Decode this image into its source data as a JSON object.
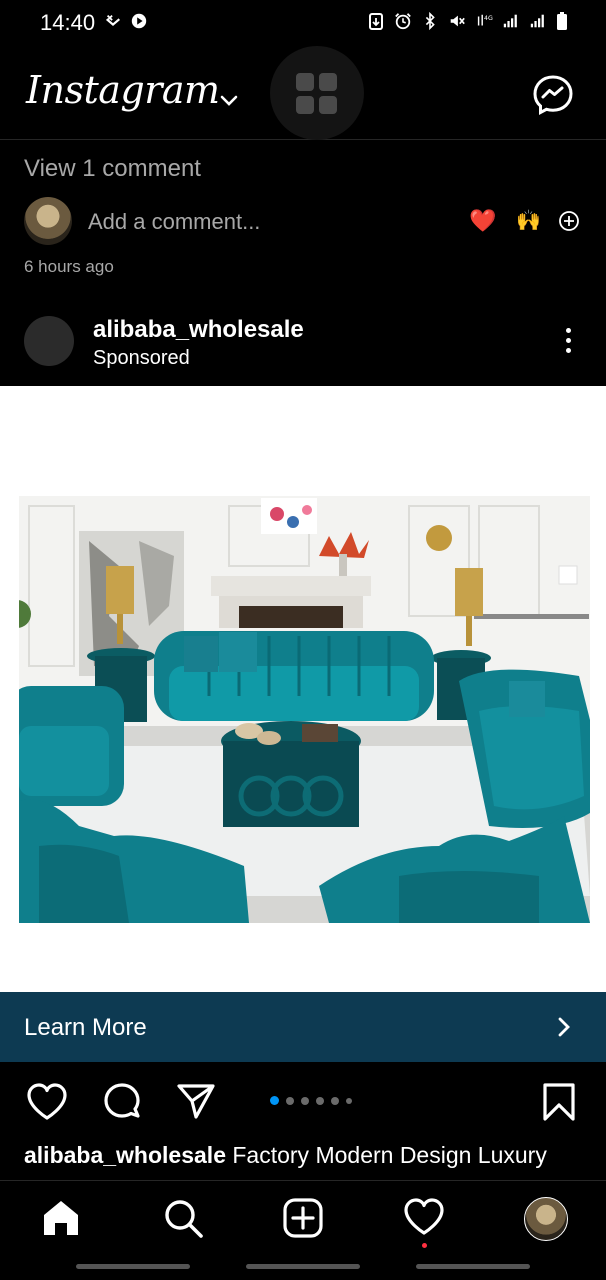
{
  "status_bar": {
    "time": "14:40",
    "left_icons": [
      "missed-call-icon",
      "youtube-icon"
    ],
    "right_icons": [
      "battery-saver-icon",
      "alarm-icon",
      "bluetooth-icon",
      "mute-icon",
      "signal-icon",
      "signal-icon",
      "signal-icon",
      "battery-icon"
    ]
  },
  "app_bar": {
    "logo_text": "Instagram",
    "icons": [
      "chevron-down-icon",
      "grid-icon",
      "messenger-icon"
    ]
  },
  "previous_post": {
    "view_comments": "View 1 comment",
    "add_comment_placeholder": "Add a comment...",
    "quick_reactions": [
      "❤️",
      "🙌"
    ],
    "time_ago": "6 hours ago"
  },
  "sponsored_post": {
    "username": "alibaba_wholesale",
    "label": "Sponsored",
    "cta_label": "Learn More",
    "carousel": {
      "count": 6,
      "active_index": 0
    },
    "caption_user": "alibaba_wholesale",
    "caption_text": "Factory Modern Design Luxury"
  },
  "colors": {
    "background": "#000000",
    "cta_background": "#0d3a52",
    "sofa_teal": "#0f7f8c",
    "active_dot": "#0095f6",
    "heart_red": "#ed1c3c"
  },
  "bottom_nav": {
    "items": [
      "home-icon",
      "search-icon",
      "create-icon",
      "activity-heart-icon",
      "profile-avatar"
    ]
  }
}
